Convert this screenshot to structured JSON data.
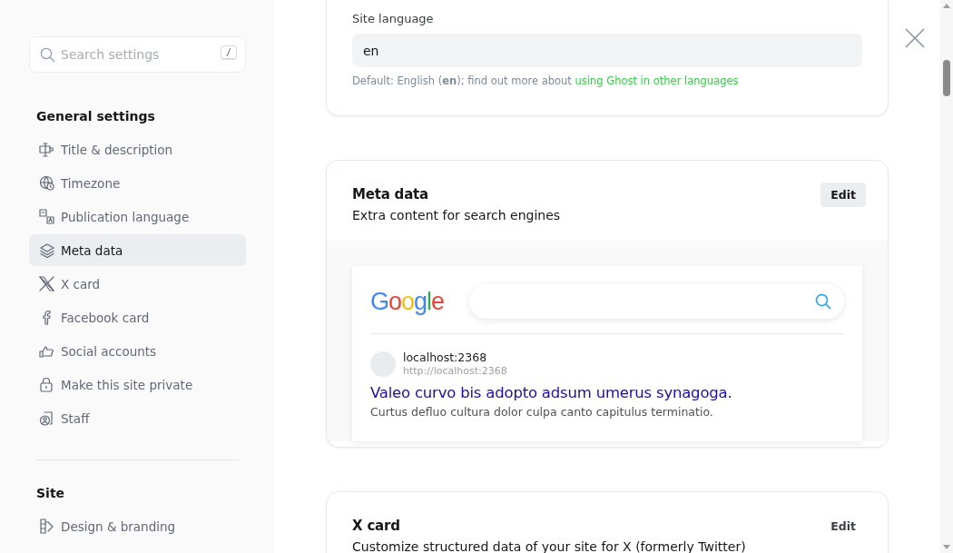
{
  "sidebar": {
    "search": {
      "placeholder": "Search settings",
      "shortcut": "/"
    },
    "sections": [
      {
        "title": "General settings",
        "items": [
          {
            "label": "Title & description",
            "selected": false
          },
          {
            "label": "Timezone",
            "selected": false
          },
          {
            "label": "Publication language",
            "selected": false
          },
          {
            "label": "Meta data",
            "selected": true
          },
          {
            "label": "X card",
            "selected": false
          },
          {
            "label": "Facebook card",
            "selected": false
          },
          {
            "label": "Social accounts",
            "selected": false
          },
          {
            "label": "Make this site private",
            "selected": false
          },
          {
            "label": "Staff",
            "selected": false
          }
        ]
      },
      {
        "title": "Site",
        "items": [
          {
            "label": "Design & branding",
            "selected": false
          }
        ]
      }
    ]
  },
  "language_card": {
    "label": "Site language",
    "value": "en",
    "hint": "Default: English (**en**); find out more about ",
    "link": "using Ghost in other languages"
  },
  "meta_card": {
    "title": "Meta data",
    "subtitle": "Extra content for search engines",
    "button": {
      "label": "Edit",
      "kind": "filled"
    },
    "preview": {
      "logo": "Google",
      "site": "localhost:2368",
      "url": "http://localhost:2368",
      "headline": "Valeo curvo bis adopto adsum umerus synagoga.",
      "description": "Curtus defluo cultura dolor culpa canto capitulus terminatio."
    }
  },
  "x_card": {
    "title": "X card",
    "subtitle": "Customize structured data of your site for X (formerly Twitter)",
    "button": {
      "label": "Edit",
      "kind": "plain"
    }
  }
}
